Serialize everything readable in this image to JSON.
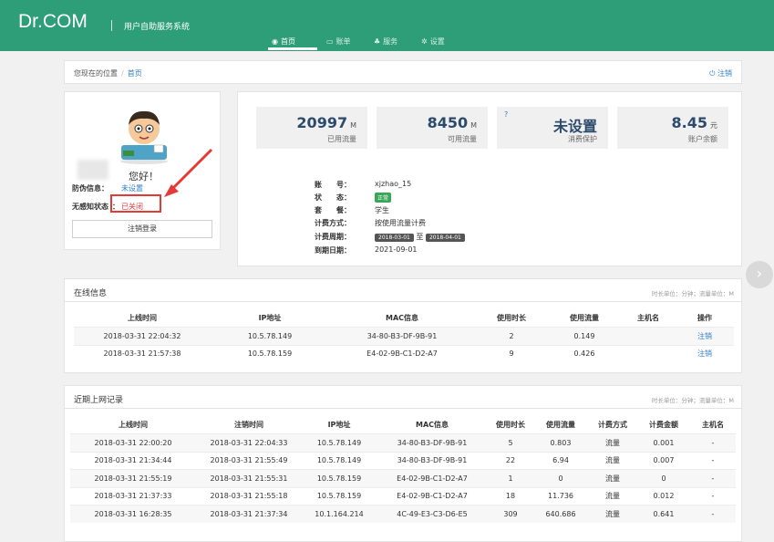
{
  "header": {
    "logo": "Dr.COM",
    "subtitle": "用户自助服务系统",
    "nav": [
      {
        "icon": "dashboard-icon",
        "glyph": "◉",
        "label": "首页",
        "active": true
      },
      {
        "icon": "bill-icon",
        "glyph": "▭",
        "label": "账单",
        "active": false
      },
      {
        "icon": "service-icon",
        "glyph": "♣",
        "label": "服务",
        "active": false
      },
      {
        "icon": "gear-icon",
        "glyph": "✲",
        "label": "设置",
        "active": false
      }
    ]
  },
  "breadcrumb": {
    "prefix": "您现在的位置",
    "separator": "/",
    "current": "首页",
    "logout": "注销",
    "logout_icon": "⏻"
  },
  "user": {
    "greeting": "您好！",
    "anti_fraud_label": "防伪信息：",
    "anti_fraud_value": "未设置",
    "seamless_label": "无感知状态",
    "seamless_sep": "：",
    "seamless_value": "已关闭",
    "logout_button": "注销登录"
  },
  "stats": [
    {
      "value": "20997",
      "unit": "M",
      "label": "已用流量"
    },
    {
      "value": "8450",
      "unit": "M",
      "label": "可用流量"
    },
    {
      "value": "未设置",
      "unit": "",
      "label": "消费保护",
      "help_icon": "?"
    },
    {
      "value": "8.45",
      "unit": "元",
      "label": "账户余额"
    }
  ],
  "account_info": {
    "account_label": "账　　号：",
    "account": "xjzhao_15",
    "status_label": "状　　态：",
    "status": "正常",
    "plan_label": "套　　餐：",
    "plan": "学生",
    "billing_label": "计费方式：",
    "billing": "按使用流量计费",
    "cycle_label": "计费周期：",
    "cycle_start": "2018-03-01",
    "cycle_to": "至",
    "cycle_end": "2018-04-01",
    "expire_label": "到期日期：",
    "expire": "2021-09-01"
  },
  "online": {
    "title": "在线信息",
    "unit_note": "时长单位：分钟；流量单位：M",
    "columns": [
      "上线时间",
      "IP地址",
      "MAC信息",
      "使用时长",
      "使用流量",
      "主机名",
      "操作"
    ],
    "rows": [
      [
        "2018-03-31 22:04:32",
        "10.5.78.149",
        "34-80-B3-DF-9B-91",
        "2",
        "0.149",
        "",
        "注销"
      ],
      [
        "2018-03-31 21:57:38",
        "10.5.78.159",
        "E4-02-9B-C1-D2-A7",
        "9",
        "0.426",
        "",
        "注销"
      ]
    ]
  },
  "recent": {
    "title": "近期上网记录",
    "unit_note": "时长单位：分钟；流量单位：M",
    "columns": [
      "上线时间",
      "注销时间",
      "IP地址",
      "MAC信息",
      "使用时长",
      "使用流量",
      "计费方式",
      "计费金额",
      "主机名"
    ],
    "rows": [
      [
        "2018-03-31 22:00:20",
        "2018-03-31 22:04:33",
        "10.5.78.149",
        "34-80-B3-DF-9B-91",
        "5",
        "0.803",
        "流量",
        "0.001",
        "-"
      ],
      [
        "2018-03-31 21:34:44",
        "2018-03-31 21:55:49",
        "10.5.78.149",
        "34-80-B3-DF-9B-91",
        "22",
        "6.94",
        "流量",
        "0.007",
        "-"
      ],
      [
        "2018-03-31 21:55:19",
        "2018-03-31 21:55:31",
        "10.5.78.159",
        "E4-02-9B-C1-D2-A7",
        "1",
        "0",
        "流量",
        "0",
        "-"
      ],
      [
        "2018-03-31 21:37:33",
        "2018-03-31 21:55:18",
        "10.5.78.159",
        "E4-02-9B-C1-D2-A7",
        "18",
        "11.736",
        "流量",
        "0.012",
        "-"
      ],
      [
        "2018-03-31 16:28:35",
        "2018-03-31 21:37:34",
        "10.1.164.214",
        "4C-49-E3-C3-D6-E5",
        "309",
        "640.686",
        "流量",
        "0.641",
        "-"
      ]
    ]
  },
  "colors": {
    "brand": "#2e9e78",
    "link": "#2f7fc4",
    "alert": "#d9383a",
    "annotation": "#e53935"
  }
}
